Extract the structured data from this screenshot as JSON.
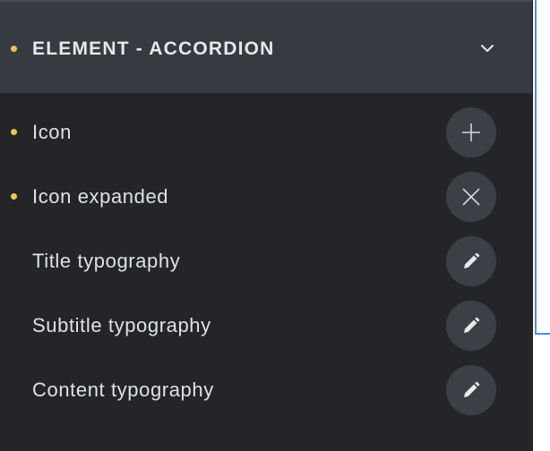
{
  "colors": {
    "panel_bg": "#232529",
    "header_bg": "#363b41",
    "accent_dot": "#f3c44e",
    "text": "#dfe2e5",
    "button_bg": "#3b4047",
    "selection_outline": "#4a90d9"
  },
  "header": {
    "title": "ELEMENT - ACCORDION",
    "toggle_icon": "chevron-down-icon",
    "modified": true
  },
  "rows": [
    {
      "label": "Icon",
      "modified": true,
      "button_icon": "plus-icon"
    },
    {
      "label": "Icon expanded",
      "modified": true,
      "button_icon": "close-icon"
    },
    {
      "label": "Title typography",
      "modified": false,
      "button_icon": "pencil-icon"
    },
    {
      "label": "Subtitle typography",
      "modified": false,
      "button_icon": "pencil-icon"
    },
    {
      "label": "Content typography",
      "modified": false,
      "button_icon": "pencil-icon"
    }
  ]
}
